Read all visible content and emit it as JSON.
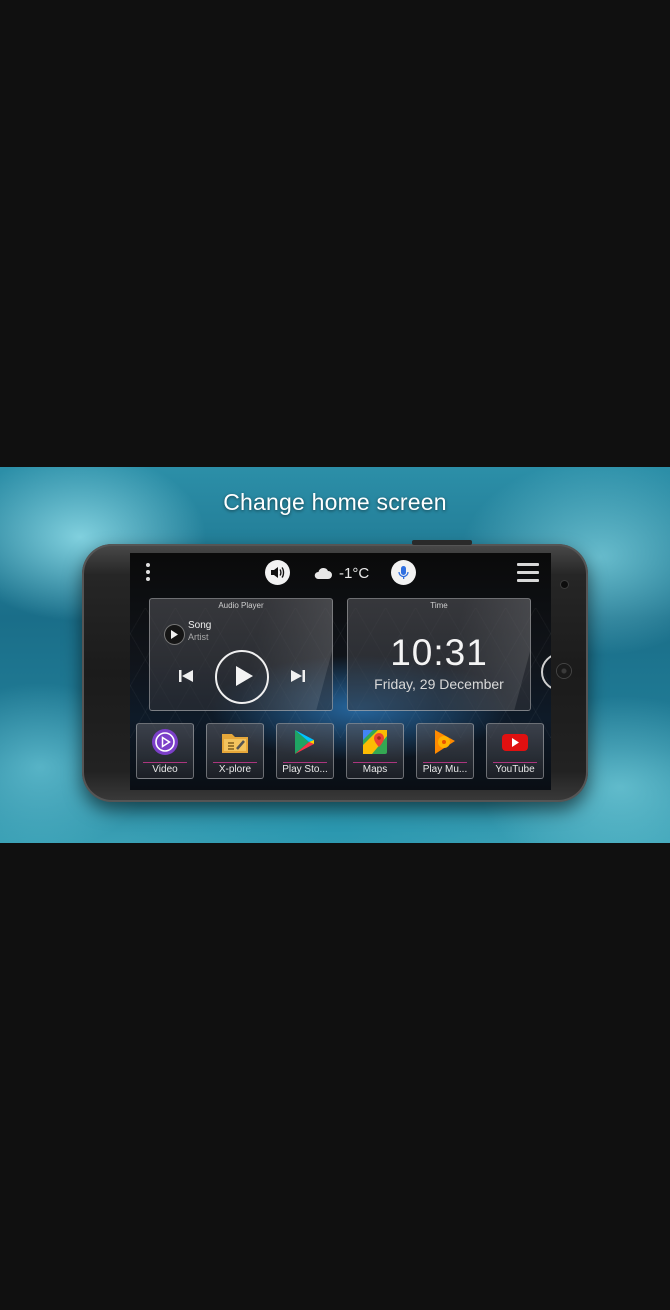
{
  "banner": {
    "title": "Change home screen"
  },
  "statusbar": {
    "weather_text": "-1°C",
    "icons": [
      "menu-dots-icon",
      "volume-icon",
      "cloud-icon",
      "microphone-icon",
      "hamburger-menu-icon"
    ]
  },
  "audio_widget": {
    "label": "Audio Player",
    "song": "Song",
    "artist": "Artist"
  },
  "time_widget": {
    "label": "Time",
    "time": "10:31",
    "date": "Friday, 29 December"
  },
  "dock": {
    "apps": [
      {
        "label": "Video",
        "icon": "video-icon"
      },
      {
        "label": "X-plore",
        "icon": "folder-icon"
      },
      {
        "label": "Play Sto...",
        "icon": "play-store-icon"
      },
      {
        "label": "Maps",
        "icon": "maps-icon"
      },
      {
        "label": "Play Mu...",
        "icon": "play-music-icon"
      },
      {
        "label": "YouTube",
        "icon": "youtube-icon"
      }
    ]
  },
  "colors": {
    "background": "#101010",
    "banner_teal": "#2c8fa8",
    "accent_pink": "#e63ca0",
    "mic_blue": "#2f6fe0",
    "youtube_red": "#e01010"
  }
}
